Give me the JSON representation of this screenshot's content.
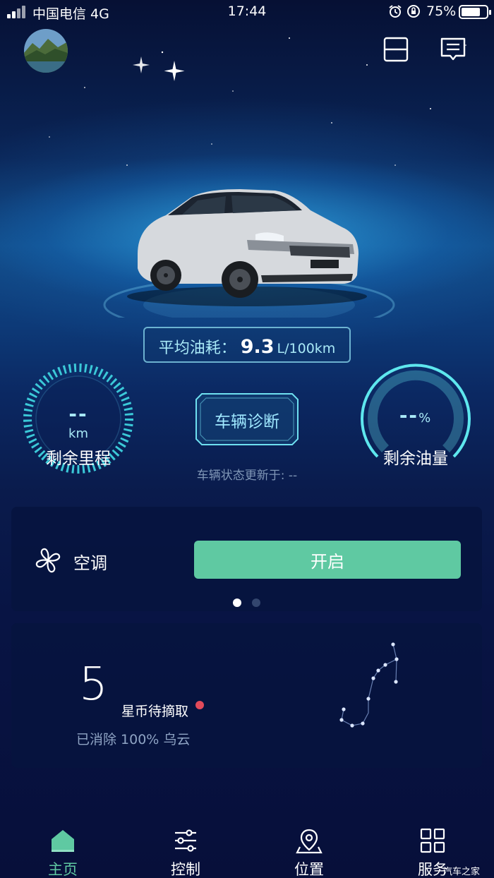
{
  "status_bar": {
    "carrier": "中国电信 4G",
    "time": "17:44",
    "battery": "75%",
    "battery_level": 0.75
  },
  "header": {
    "avatar_icon": "avatar-landscape",
    "scan_icon": "scan-icon",
    "message_icon": "message-icon"
  },
  "vehicle": {
    "fuel_label": "平均油耗：",
    "fuel_value": "9.3",
    "fuel_unit": "L/100km",
    "range_value": "--",
    "range_unit": "km",
    "range_label": "剩余里程",
    "fuel_level_value": "--",
    "fuel_level_unit": "%",
    "fuel_level_label": "剩余油量",
    "diagnosis_label": "车辆诊断",
    "status_update": "车辆状态更新于: --"
  },
  "control_card": {
    "ac_label": "空调",
    "ac_button": "开启",
    "page_count": 2,
    "active_page": 1
  },
  "coin_card": {
    "count": "5",
    "label": "星币待摘取",
    "subtitle": "已消除 100% 乌云"
  },
  "tabbar": {
    "items": [
      {
        "label": "主页",
        "icon": "home-icon",
        "active": true
      },
      {
        "label": "控制",
        "icon": "sliders-icon",
        "active": false
      },
      {
        "label": "位置",
        "icon": "location-icon",
        "active": false
      },
      {
        "label": "服务",
        "icon": "grid-icon",
        "active": false
      }
    ]
  },
  "watermark": "汽车之家",
  "colors": {
    "accent": "#5fc9a2",
    "cyan": "#a9e9f7",
    "badge": "#e24a5a"
  }
}
